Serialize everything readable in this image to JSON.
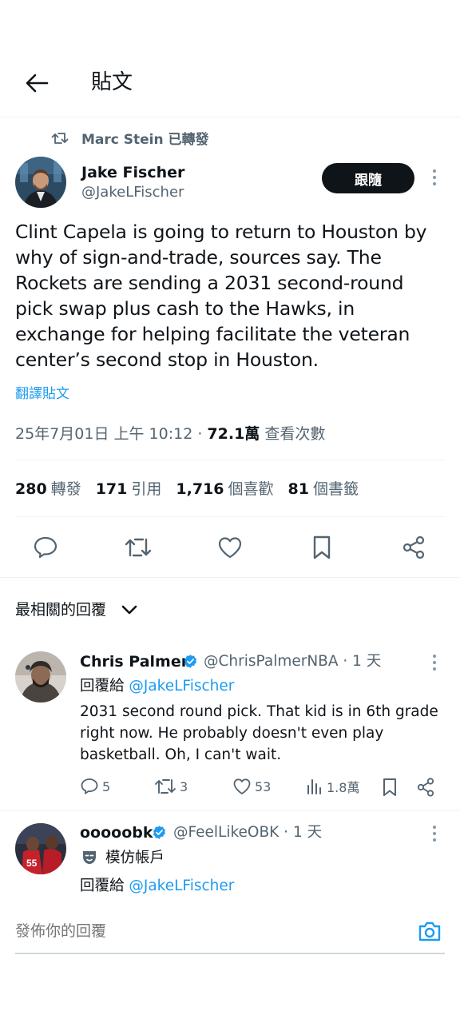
{
  "header": {
    "title": "貼文"
  },
  "retweet_note": "Marc Stein 已轉發",
  "tweet": {
    "author_name": "Jake Fischer",
    "author_handle": "@JakeLFischer",
    "follow_label": "跟隨",
    "text": "Clint Capela is going to return to Houston by why of sign-and-trade, sources say. The Rockets are sending a 2031 second-round pick swap plus cash to the Hawks, in exchange for helping facilitate the veteran center’s second stop in Houston.",
    "translate_label": "翻譯貼文",
    "timestamp": "25年7月01日 上午 10:12",
    "separator": " · ",
    "views_count": "72.1萬",
    "views_label": " 查看次數"
  },
  "stats": [
    {
      "count": "280",
      "label": "轉發"
    },
    {
      "count": "171",
      "label": "引用"
    },
    {
      "count": "1,716",
      "label": "個喜歡"
    },
    {
      "count": "81",
      "label": "個書籤"
    }
  ],
  "sort": {
    "label": "最相關的回覆"
  },
  "replies": [
    {
      "name": "Chris Palmer",
      "handle": "@ChrisPalmerNBA · 1 天",
      "reply_to_prefix": "回覆給 ",
      "reply_to": "@JakeLFischer",
      "text": "2031 second round pick. That kid is in 6th grade right now. He probably doesn't even play basketball. Oh, I can't wait.",
      "replies_count": "5",
      "retweets_count": "3",
      "likes_count": "53",
      "views_count": "1.8萬"
    },
    {
      "name": "ooooobk",
      "handle": "@FeelLikeOBK · 1 天",
      "parody_label": "模仿帳戶",
      "reply_to_prefix": "回覆給 ",
      "reply_to": "@JakeLFischer"
    }
  ],
  "compose": {
    "placeholder": "發佈你的回覆"
  },
  "colors": {
    "accent": "#1d9bf0",
    "text": "#0f1419",
    "muted": "#536471",
    "divider": "#eff3f4"
  }
}
